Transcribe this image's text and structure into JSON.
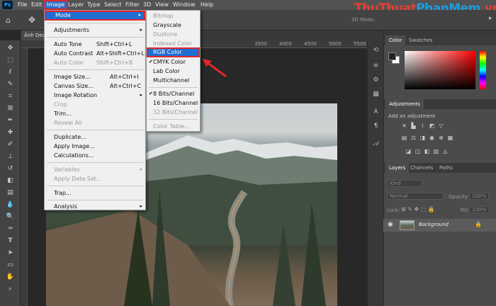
{
  "menubar": {
    "items": [
      "File",
      "Edit",
      "Image",
      "Layer",
      "Type",
      "Select",
      "Filter",
      "3D",
      "View",
      "Window",
      "Help"
    ]
  },
  "optbar": {
    "mode3d": "3D Mode:"
  },
  "doc": {
    "tab_label": "Ảnh Des"
  },
  "ruler": {
    "ticks": [
      "3500",
      "4000",
      "4500",
      "5000",
      "5500"
    ]
  },
  "image_menu": [
    {
      "label": "Mode",
      "arrow": "▸"
    },
    {
      "label": "Adjustments",
      "arrow": "▸"
    },
    {
      "label": "Auto Tone",
      "shortcut": "Shift+Ctrl+L"
    },
    {
      "label": "Auto Contrast",
      "shortcut": "Alt+Shift+Ctrl+L"
    },
    {
      "label": "Auto Color",
      "shortcut": "Shift+Ctrl+B"
    },
    {
      "label": "Image Size...",
      "shortcut": "Alt+Ctrl+I"
    },
    {
      "label": "Canvas Size...",
      "shortcut": "Alt+Ctrl+C"
    },
    {
      "label": "Image Rotation",
      "arrow": "▸"
    },
    {
      "label": "Crop"
    },
    {
      "label": "Trim..."
    },
    {
      "label": "Reveal All"
    },
    {
      "label": "Duplicate..."
    },
    {
      "label": "Apply Image..."
    },
    {
      "label": "Calculations..."
    },
    {
      "label": "Variables",
      "arrow": "▸"
    },
    {
      "label": "Apply Data Set..."
    },
    {
      "label": "Trap..."
    },
    {
      "label": "Analysis",
      "arrow": "▸"
    }
  ],
  "mode_menu": [
    {
      "label": "Bitmap"
    },
    {
      "label": "Grayscale"
    },
    {
      "label": "Duotone"
    },
    {
      "label": "Indexed Color"
    },
    {
      "label": "RGB Color"
    },
    {
      "label": "CMYK Color",
      "check": "✔"
    },
    {
      "label": "Lab Color"
    },
    {
      "label": "Multichannel"
    },
    {
      "label": "8 Bits/Channel",
      "check": "✔"
    },
    {
      "label": "16 Bits/Channel"
    },
    {
      "label": "32 Bits/Channel"
    },
    {
      "label": "Color Table..."
    }
  ],
  "panels": {
    "color_tab": "Color",
    "swatches_tab": "Swatches",
    "adjustments_tab": "Adjustments",
    "add_adjustment": "Add an adjustment",
    "layers_tab": "Layers",
    "channels_tab": "Channels",
    "paths_tab": "Paths",
    "kind": "Kind",
    "blend": "Normal",
    "opacity_label": "Opacity:",
    "opacity_value": "100%",
    "lock_label": "Lock:",
    "fill_label": "Fill:",
    "fill_value": "100%",
    "layer_name": "Background"
  },
  "watermark": {
    "thu": "Thu",
    "thuat": "Thuat",
    "phan": "Phan",
    "mem": "Mem",
    ".vn": ".vn"
  },
  "colors": {
    "highlight": "#1f6ed1",
    "callout": "#e0262b"
  }
}
